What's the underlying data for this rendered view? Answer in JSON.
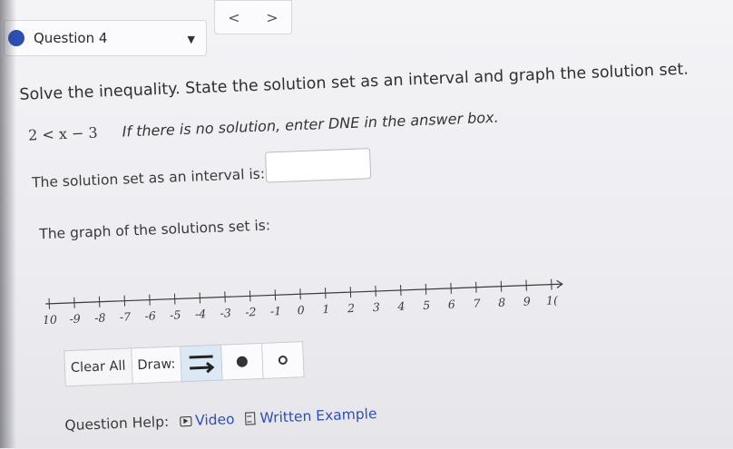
{
  "question_selector": {
    "label": "Question 4",
    "accent": "#2b4fb3"
  },
  "nav": {
    "prev": "<",
    "next": ">"
  },
  "instruction": "Solve the inequality. State the solution set as an interval and graph the solution set.",
  "inequality": "2 < x − 3",
  "dne_note": "If there is no solution, enter DNE in the answer box.",
  "interval_label": "The solution set as an interval is:",
  "interval_answer": "",
  "graph_label": "The graph of the solutions set is:",
  "number_line": {
    "min": -10,
    "max": 10,
    "tick_labels": [
      "10",
      "-9",
      "-8",
      "-7",
      "-6",
      "-5",
      "-4",
      "-3",
      "-2",
      "-1",
      "0",
      "1",
      "2",
      "3",
      "4",
      "5",
      "6",
      "7",
      "8",
      "9",
      "1("
    ]
  },
  "toolbar": {
    "clear": "Clear All",
    "draw": "Draw:",
    "tools": [
      "ray-tool-icon",
      "closed-dot-icon",
      "open-dot-icon"
    ]
  },
  "help": {
    "label": "Question Help:",
    "video": "Video",
    "written": "Written Example",
    "link_color": "#2f4fb0"
  }
}
